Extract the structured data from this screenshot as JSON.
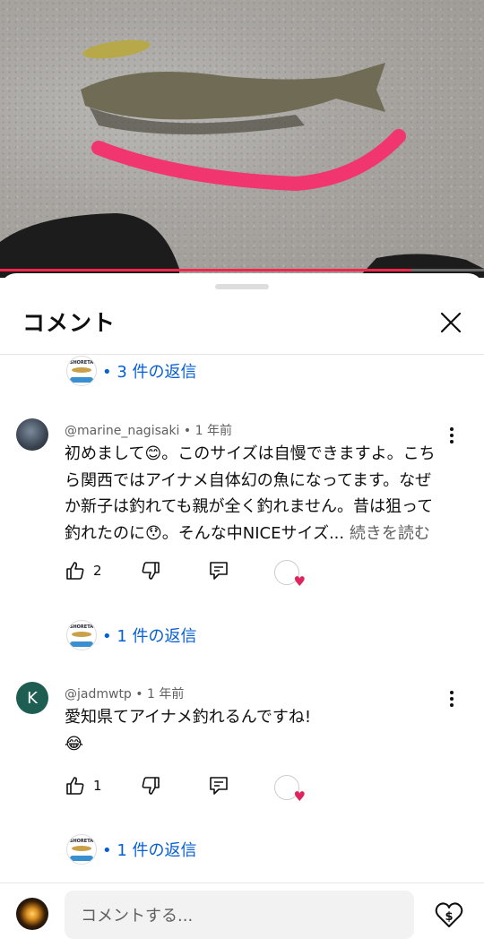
{
  "video": {
    "progress_percent": 85
  },
  "sheet": {
    "title": "コメント"
  },
  "threads": [
    {
      "replies_label": "• 3 件の返信"
    },
    {
      "author": "@marine_nagisaki",
      "separator": " • ",
      "time": "1 年前",
      "text": "初めまして😊。このサイズは自慢できますよ。こちら関西ではアイナメ自体幻の魚になってます。なぜか新子は釣れても親が全く釣れません。昔は狙って釣れたのに😯。そんな中NICEサイズ...",
      "read_more": "続きを読む",
      "likes": "2",
      "replies_label": "• 1 件の返信"
    },
    {
      "author": "@jadmwtp",
      "separator": " • ",
      "time": "1 年前",
      "avatar_letter": "K",
      "text": "愛知県てアイナメ釣れるんですね!",
      "emoji_line": "😂",
      "likes": "1",
      "replies_label": "• 1 件の返信"
    }
  ],
  "creator_logo_text": "SHORETA",
  "composer": {
    "placeholder": "コメントする..."
  },
  "colors": {
    "accent": "#065fd4",
    "progress": "#f1264b",
    "heart": "#e0245e",
    "avatar_k": "#1e5e52"
  },
  "icons": [
    "close-icon",
    "like-icon",
    "dislike-icon",
    "reply-icon",
    "more-vert-icon",
    "super-thanks-icon"
  ]
}
